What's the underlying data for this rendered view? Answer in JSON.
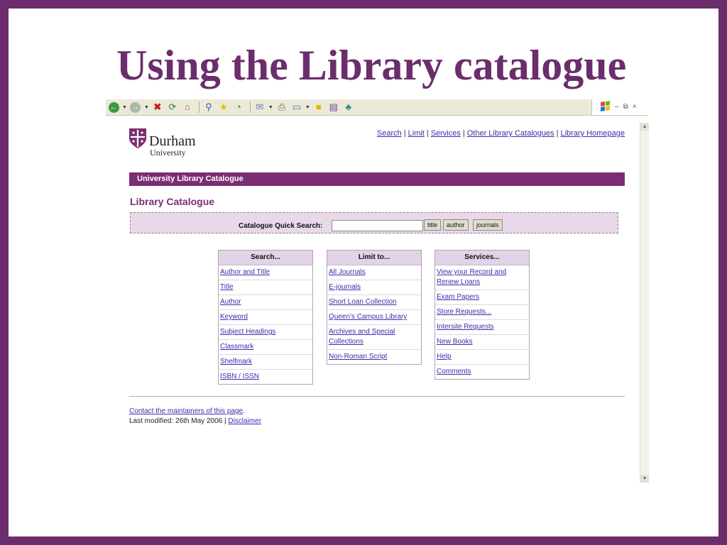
{
  "slide": {
    "title": "Using the Library catalogue"
  },
  "toolbar": {
    "icons": [
      "back-icon",
      "forward-icon",
      "stop-icon",
      "refresh-icon",
      "home-icon",
      "search-icon",
      "favorites-icon",
      "history-icon",
      "mail-icon",
      "print-icon",
      "edit-icon",
      "discuss-icon",
      "research-icon",
      "messenger-icon"
    ],
    "window_controls": [
      "–",
      "⧉",
      "×"
    ]
  },
  "page": {
    "logo": {
      "name": "Durham",
      "sub": "University"
    },
    "nav": {
      "links": [
        "Search",
        "Limit",
        "Services",
        "Other Library Catalogues",
        "Library Homepage"
      ],
      "separator": "|"
    },
    "banner": "University Library Catalogue",
    "heading": "Library Catalogue",
    "quick_search": {
      "label": "Catalogue Quick Search:",
      "value": "",
      "buttons": [
        "title",
        "author",
        "journals"
      ]
    },
    "panels": [
      {
        "title": "Search...",
        "items": [
          "Author and Title",
          "Title",
          "Author",
          "Keyword",
          "Subject Headings",
          "Classmark",
          "Shelfmark",
          "ISBN / ISSN"
        ]
      },
      {
        "title": "Limit to...",
        "items": [
          "All Journals",
          "E-journals",
          "Short Loan Collection",
          "Queen's Campus Library",
          "Archives and Special Collections",
          "Non-Roman Script"
        ]
      },
      {
        "title": "Services...",
        "items": [
          "View your Record and Renew Loans",
          "Exam Papers",
          "Store Requests...",
          "Intersite Requests",
          "New Books",
          "Help",
          "Comments"
        ]
      }
    ],
    "footer": {
      "contact_link": "Contact the maintainers of this page",
      "contact_suffix": ".",
      "modified": "Last modified: 26th May 2006 |",
      "disclaimer": "Disclaimer"
    }
  },
  "colors": {
    "frame": "#6b2d6b",
    "brand": "#7b2d74",
    "panel_head": "#e3d3e6",
    "link": "#3b2ea8"
  }
}
